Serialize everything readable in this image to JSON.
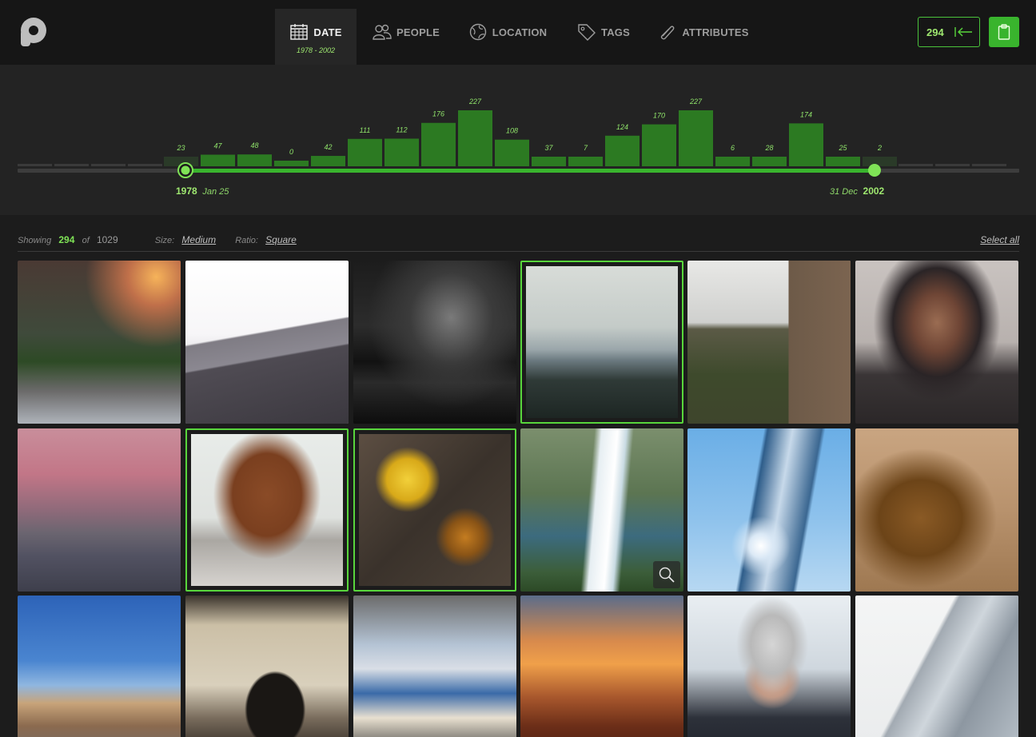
{
  "nav": {
    "tabs": [
      {
        "label": "DATE",
        "sub": "1978 - 2002",
        "icon": "calendar-icon",
        "active": true
      },
      {
        "label": "PEOPLE",
        "icon": "people-icon"
      },
      {
        "label": "LOCATION",
        "icon": "globe-icon"
      },
      {
        "label": "TAGS",
        "icon": "tag-icon"
      },
      {
        "label": "ATTRIBUTES",
        "icon": "paperclip-icon"
      }
    ],
    "selected_count": "294",
    "collapse_icon": "arrow-left-bar-icon",
    "action_icon": "clipboard-icon"
  },
  "timeline": {
    "bars": [
      "23",
      "47",
      "48",
      "0",
      "42",
      "111",
      "112",
      "176",
      "227",
      "108",
      "37",
      "7",
      "124",
      "170",
      "227",
      "6",
      "28",
      "174",
      "25",
      "2"
    ],
    "start": {
      "year": "1978",
      "date": "Jan 25"
    },
    "end": {
      "year": "2002",
      "date": "31 Dec"
    }
  },
  "toolbar": {
    "showing_label": "Showing",
    "showing_count": "294",
    "of_label": "of",
    "total": "1029",
    "size_label": "Size:",
    "size_value": "Medium",
    "ratio_label": "Ratio:",
    "ratio_value": "Square",
    "select_all": "Select all"
  },
  "photos": [
    {
      "name": "photo-flowers-sunset",
      "selected": false
    },
    {
      "name": "photo-misty-mountains",
      "selected": false
    },
    {
      "name": "photo-dark-clouds-sea",
      "selected": false
    },
    {
      "name": "photo-snowy-volcano",
      "selected": true
    },
    {
      "name": "photo-woman-by-window",
      "selected": false
    },
    {
      "name": "photo-boy-in-hood",
      "selected": false
    },
    {
      "name": "photo-church-pink-clouds",
      "selected": false
    },
    {
      "name": "photo-leather-bag",
      "selected": true
    },
    {
      "name": "photo-turmeric-drink",
      "selected": true
    },
    {
      "name": "photo-waterfall",
      "selected": false,
      "zoom": true
    },
    {
      "name": "photo-curvy-towers",
      "selected": false
    },
    {
      "name": "photo-roaring-lion",
      "selected": false
    },
    {
      "name": "photo-desert-road",
      "selected": false
    },
    {
      "name": "photo-man-silhouette-window",
      "selected": false
    },
    {
      "name": "photo-graffiti-sneakers",
      "selected": false
    },
    {
      "name": "photo-mountain-sunrise",
      "selected": false
    },
    {
      "name": "photo-woman-blowing-snow",
      "selected": false
    },
    {
      "name": "photo-glass-building",
      "selected": false
    }
  ],
  "colors": {
    "accent": "#39b42d",
    "accent_light": "#7fe356",
    "bar": "#2c7a22",
    "background": "#1c1c1c"
  }
}
